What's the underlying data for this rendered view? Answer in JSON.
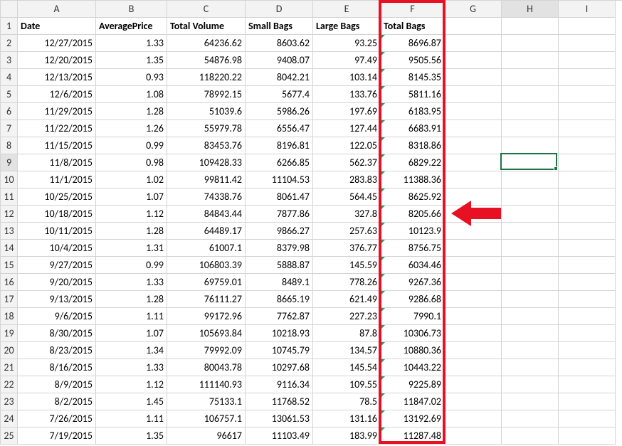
{
  "columns": [
    "A",
    "B",
    "C",
    "D",
    "E",
    "F",
    "G",
    "H",
    "I"
  ],
  "headers": [
    "Date",
    "AveragePrice",
    "Total Volume",
    "Small Bags",
    "Large Bags",
    "Total Bags"
  ],
  "rows": [
    {
      "n": 1
    },
    {
      "n": 2,
      "A": "12/27/2015",
      "B": "1.33",
      "C": "64236.62",
      "D": "8603.62",
      "E": "93.25",
      "F": "8696.87"
    },
    {
      "n": 3,
      "A": "12/20/2015",
      "B": "1.35",
      "C": "54876.98",
      "D": "9408.07",
      "E": "97.49",
      "F": "9505.56"
    },
    {
      "n": 4,
      "A": "12/13/2015",
      "B": "0.93",
      "C": "118220.22",
      "D": "8042.21",
      "E": "103.14",
      "F": "8145.35"
    },
    {
      "n": 5,
      "A": "12/6/2015",
      "B": "1.08",
      "C": "78992.15",
      "D": "5677.4",
      "E": "133.76",
      "F": "5811.16"
    },
    {
      "n": 6,
      "A": "11/29/2015",
      "B": "1.28",
      "C": "51039.6",
      "D": "5986.26",
      "E": "197.69",
      "F": "6183.95"
    },
    {
      "n": 7,
      "A": "11/22/2015",
      "B": "1.26",
      "C": "55979.78",
      "D": "6556.47",
      "E": "127.44",
      "F": "6683.91"
    },
    {
      "n": 8,
      "A": "11/15/2015",
      "B": "0.99",
      "C": "83453.76",
      "D": "8196.81",
      "E": "122.05",
      "F": "8318.86"
    },
    {
      "n": 9,
      "A": "11/8/2015",
      "B": "0.98",
      "C": "109428.33",
      "D": "6266.85",
      "E": "562.37",
      "F": "6829.22"
    },
    {
      "n": 10,
      "A": "11/1/2015",
      "B": "1.02",
      "C": "99811.42",
      "D": "11104.53",
      "E": "283.83",
      "F": "11388.36"
    },
    {
      "n": 11,
      "A": "10/25/2015",
      "B": "1.07",
      "C": "74338.76",
      "D": "8061.47",
      "E": "564.45",
      "F": "8625.92"
    },
    {
      "n": 12,
      "A": "10/18/2015",
      "B": "1.12",
      "C": "84843.44",
      "D": "7877.86",
      "E": "327.8",
      "F": "8205.66"
    },
    {
      "n": 13,
      "A": "10/11/2015",
      "B": "1.28",
      "C": "64489.17",
      "D": "9866.27",
      "E": "257.63",
      "F": "10123.9"
    },
    {
      "n": 14,
      "A": "10/4/2015",
      "B": "1.31",
      "C": "61007.1",
      "D": "8379.98",
      "E": "376.77",
      "F": "8756.75"
    },
    {
      "n": 15,
      "A": "9/27/2015",
      "B": "0.99",
      "C": "106803.39",
      "D": "5888.87",
      "E": "145.59",
      "F": "6034.46"
    },
    {
      "n": 16,
      "A": "9/20/2015",
      "B": "1.33",
      "C": "69759.01",
      "D": "8489.1",
      "E": "778.26",
      "F": "9267.36"
    },
    {
      "n": 17,
      "A": "9/13/2015",
      "B": "1.28",
      "C": "76111.27",
      "D": "8665.19",
      "E": "621.49",
      "F": "9286.68"
    },
    {
      "n": 18,
      "A": "9/6/2015",
      "B": "1.11",
      "C": "99172.96",
      "D": "7762.87",
      "E": "227.23",
      "F": "7990.1"
    },
    {
      "n": 19,
      "A": "8/30/2015",
      "B": "1.07",
      "C": "105693.84",
      "D": "10218.93",
      "E": "87.8",
      "F": "10306.73"
    },
    {
      "n": 20,
      "A": "8/23/2015",
      "B": "1.34",
      "C": "79992.09",
      "D": "10745.79",
      "E": "134.57",
      "F": "10880.36"
    },
    {
      "n": 21,
      "A": "8/16/2015",
      "B": "1.33",
      "C": "80043.78",
      "D": "10297.68",
      "E": "145.54",
      "F": "10443.22"
    },
    {
      "n": 22,
      "A": "8/9/2015",
      "B": "1.12",
      "C": "111140.93",
      "D": "9116.34",
      "E": "109.55",
      "F": "9225.89"
    },
    {
      "n": 23,
      "A": "8/2/2015",
      "B": "1.45",
      "C": "75133.1",
      "D": "11768.52",
      "E": "78.5",
      "F": "11847.02"
    },
    {
      "n": 24,
      "A": "7/26/2015",
      "B": "1.11",
      "C": "106757.1",
      "D": "13061.53",
      "E": "131.16",
      "F": "13192.69"
    },
    {
      "n": 25,
      "A": "7/19/2015",
      "B": "1.35",
      "C": "96617",
      "D": "11103.49",
      "E": "183.99",
      "F": "11287.48"
    }
  ],
  "selected_cell": "H9",
  "highlighted_column": "F",
  "arrow_row": 12,
  "colors": {
    "highlight": "#e81123",
    "arrow": "#e81123",
    "sel_border": "#217346"
  }
}
